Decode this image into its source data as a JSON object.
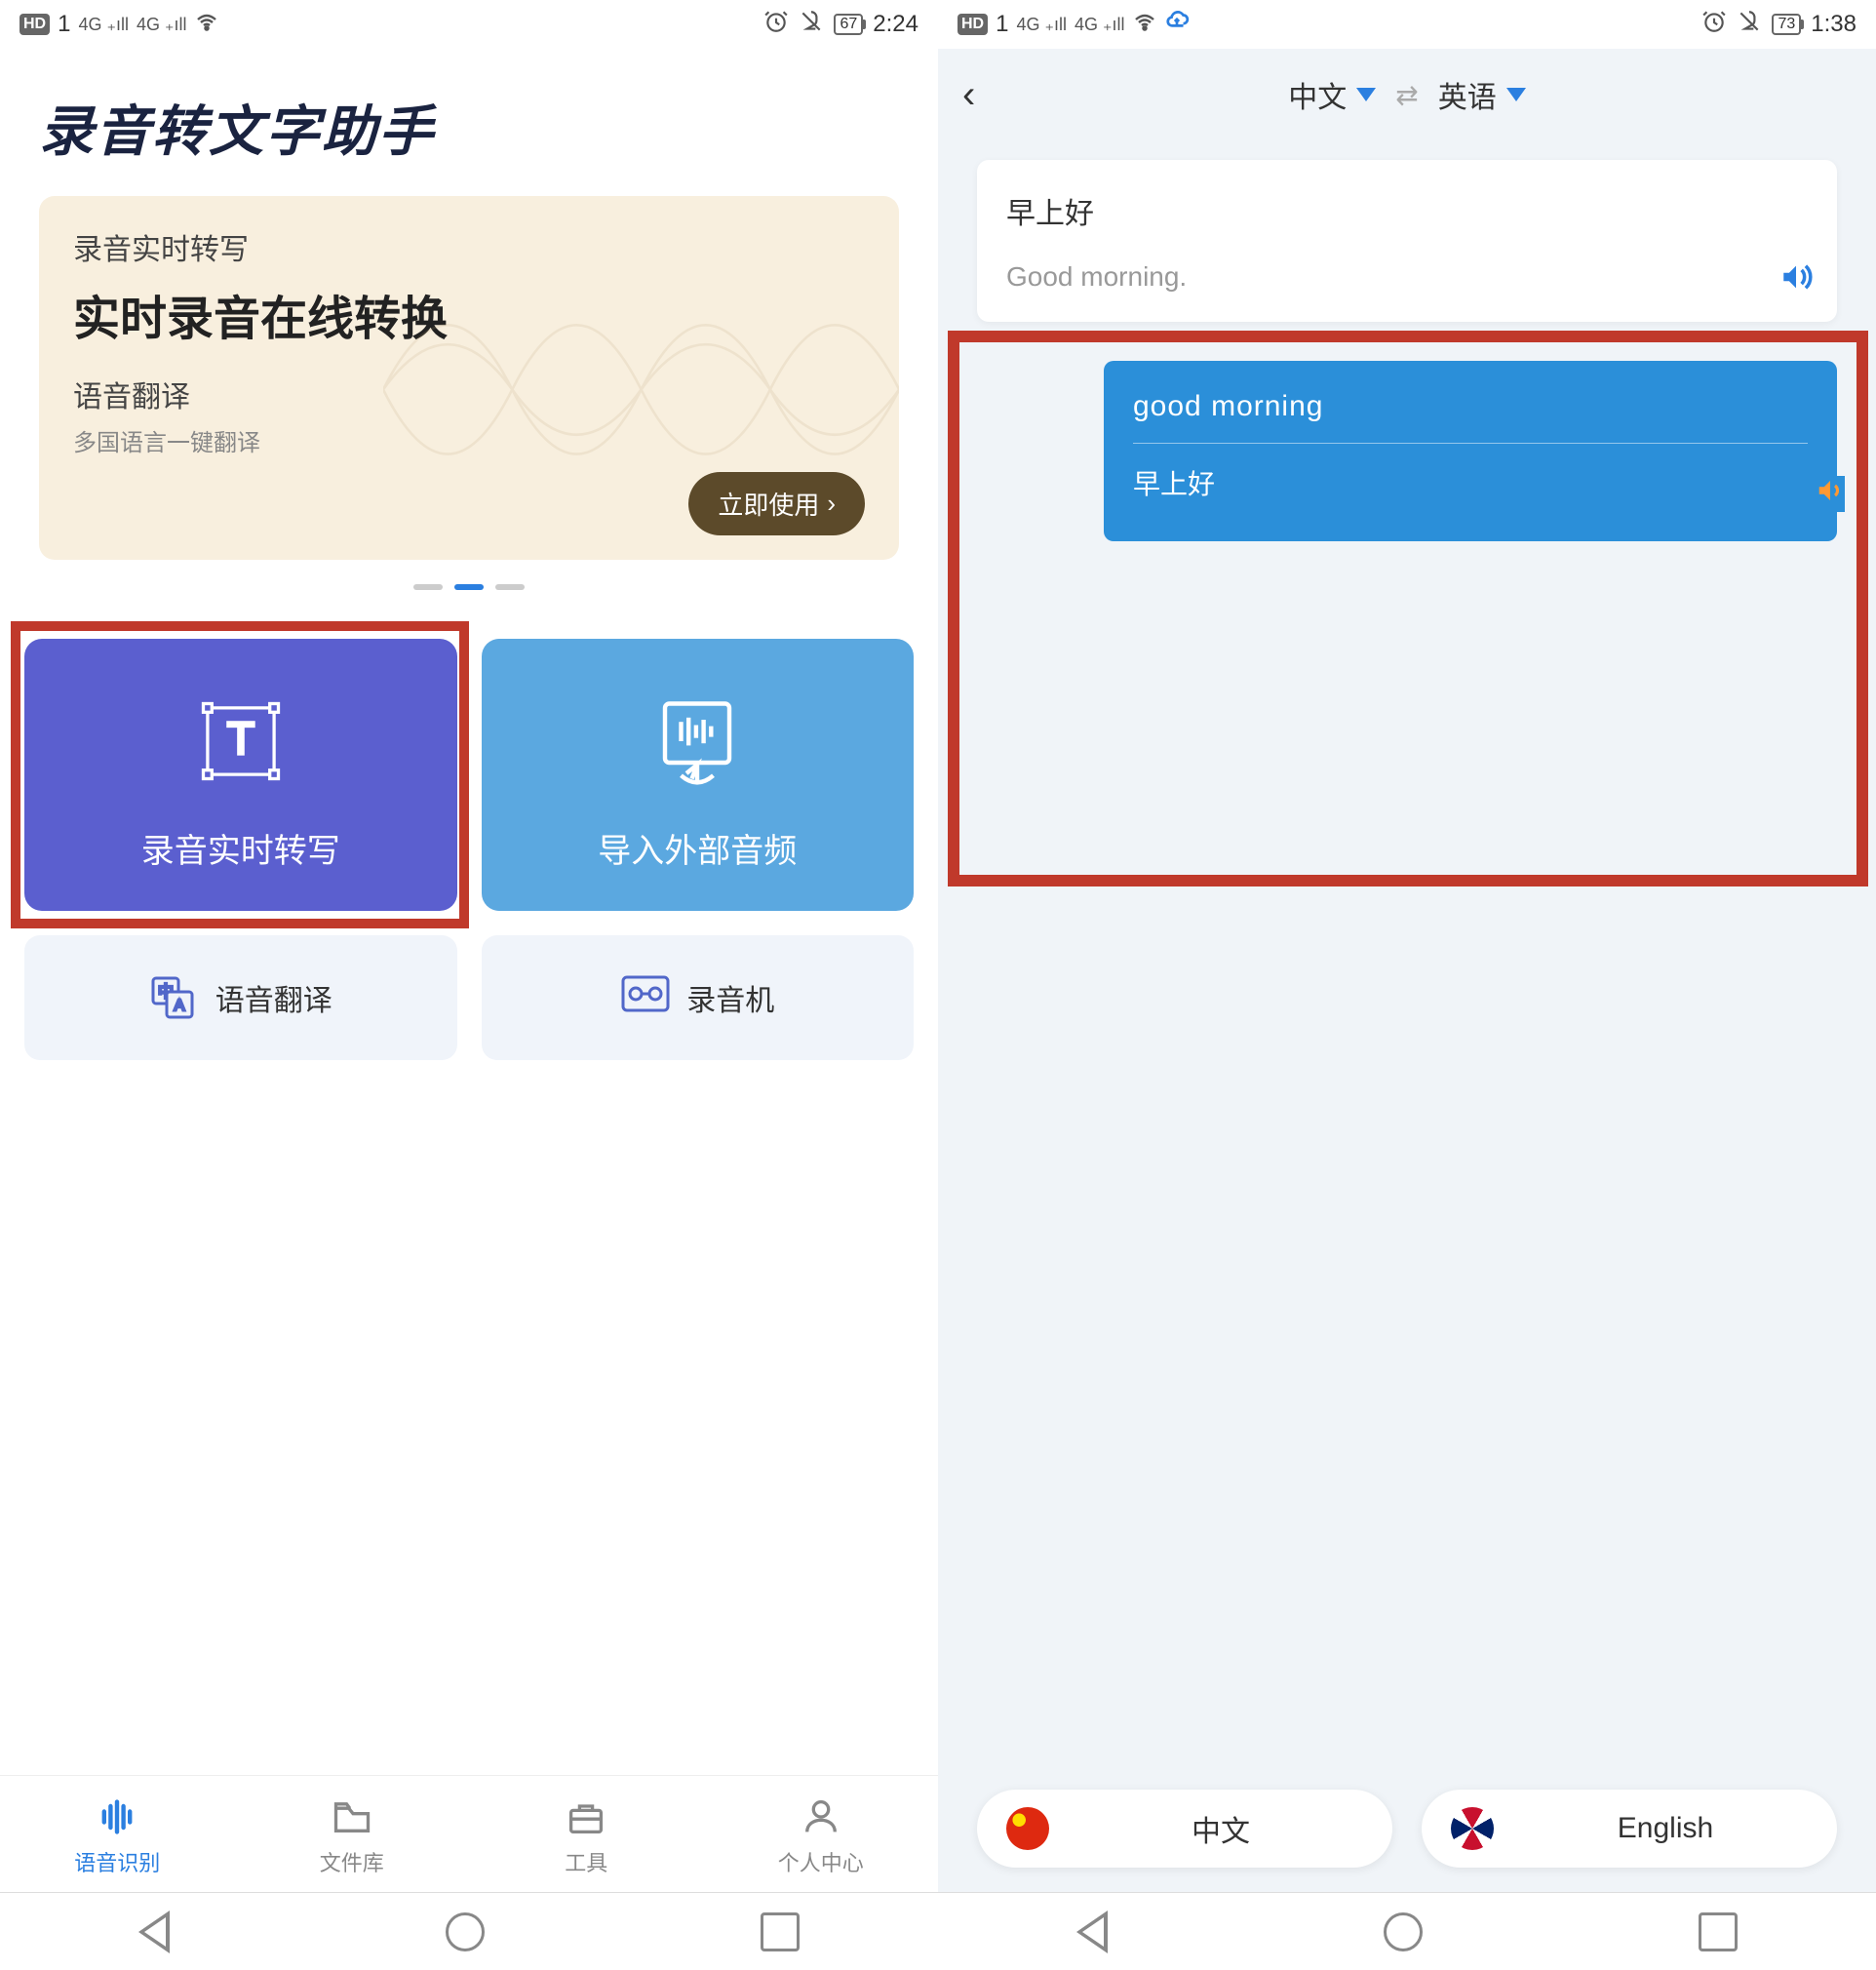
{
  "left": {
    "status": {
      "hd": "HD",
      "hdnum": "1",
      "sig": "4G",
      "battery": "67",
      "time": "2:24"
    },
    "appTitle": "录音转文字助手",
    "hero": {
      "sub1": "录音实时转写",
      "main": "实时录音在线转换",
      "sub2": "语音翻译",
      "sub3": "多国语言一键翻译",
      "cta": "立即使用"
    },
    "cards": {
      "purple": "录音实时转写",
      "blue": "导入外部音频",
      "translate": "语音翻译",
      "recorder": "录音机"
    },
    "nav": {
      "voice": "语音识别",
      "files": "文件库",
      "tools": "工具",
      "profile": "个人中心"
    }
  },
  "right": {
    "status": {
      "hd": "HD",
      "hdnum": "1",
      "sig": "4G",
      "battery": "73",
      "time": "1:38"
    },
    "langFrom": "中文",
    "langTo": "英语",
    "msg1": {
      "src": "早上好",
      "trans": "Good morning."
    },
    "msg2": {
      "src": "good morning",
      "trans": "早上好"
    },
    "btnCn": "中文",
    "btnEn": "English"
  }
}
